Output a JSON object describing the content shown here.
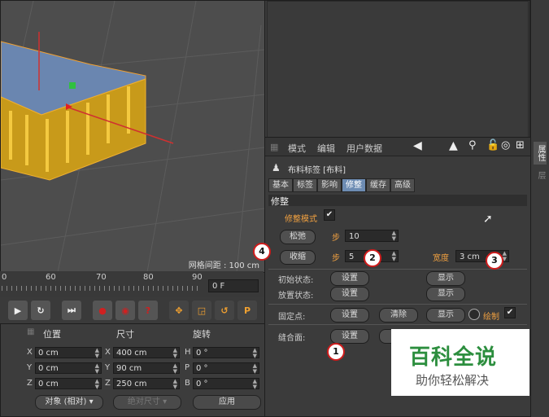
{
  "viewport": {
    "grid_readout": "网格间距 : 100 cm"
  },
  "timeline": {
    "ticks": [
      "0",
      "60",
      "70",
      "80",
      "90"
    ],
    "frame_field": "0 F"
  },
  "coords": {
    "headers": {
      "position": "位置",
      "size": "尺寸",
      "rotation": "旋转"
    },
    "position": [
      {
        "axis": "X",
        "value": "0 cm"
      },
      {
        "axis": "Y",
        "value": "0 cm"
      },
      {
        "axis": "Z",
        "value": "0 cm"
      }
    ],
    "size": [
      {
        "axis": "X",
        "value": "400 cm"
      },
      {
        "axis": "Y",
        "value": "90 cm"
      },
      {
        "axis": "Z",
        "value": "250 cm"
      }
    ],
    "rotation": [
      {
        "axis": "H",
        "value": "0 °"
      },
      {
        "axis": "P",
        "value": "0 °"
      },
      {
        "axis": "B",
        "value": "0 °"
      }
    ],
    "object_mode": "对象 (相对)",
    "size_mode": "绝对尺寸",
    "apply_label": "应用"
  },
  "attr": {
    "menu": {
      "mode": "模式",
      "edit": "编辑",
      "user_data": "用户数据"
    },
    "object_title": "布料标签 [布料]",
    "tabs": [
      "基本",
      "标签",
      "影响",
      "修整",
      "缓存",
      "高级"
    ],
    "section_title": "修整",
    "dress_mode_label": "修整模式",
    "relax_button": "松弛",
    "step_label": "步",
    "relax_steps": "10",
    "shrink_button": "收缩",
    "shrink_steps": "5",
    "width_label": "宽度",
    "width_value": "3 cm",
    "init_state_label": "初始状态:",
    "relax_state_label": "放置状态:",
    "fixed_points_label": "固定点:",
    "seam_label": "缝合面:",
    "set_label": "设置",
    "show_label": "显示",
    "clear_label": "清除",
    "draw_label": "绘制"
  },
  "right_strip": {
    "tab1": "属性",
    "tab2": "层"
  },
  "badges": [
    "1",
    "2",
    "3",
    "4"
  ],
  "watermark": {
    "title": "百科全说",
    "subtitle": "助你轻松解决"
  },
  "colors": {
    "accent_orange": "#f0a040",
    "active_tab": "#6d8cb3",
    "badge_red": "#d01c1c",
    "watermark_green": "#2c8e3e"
  }
}
